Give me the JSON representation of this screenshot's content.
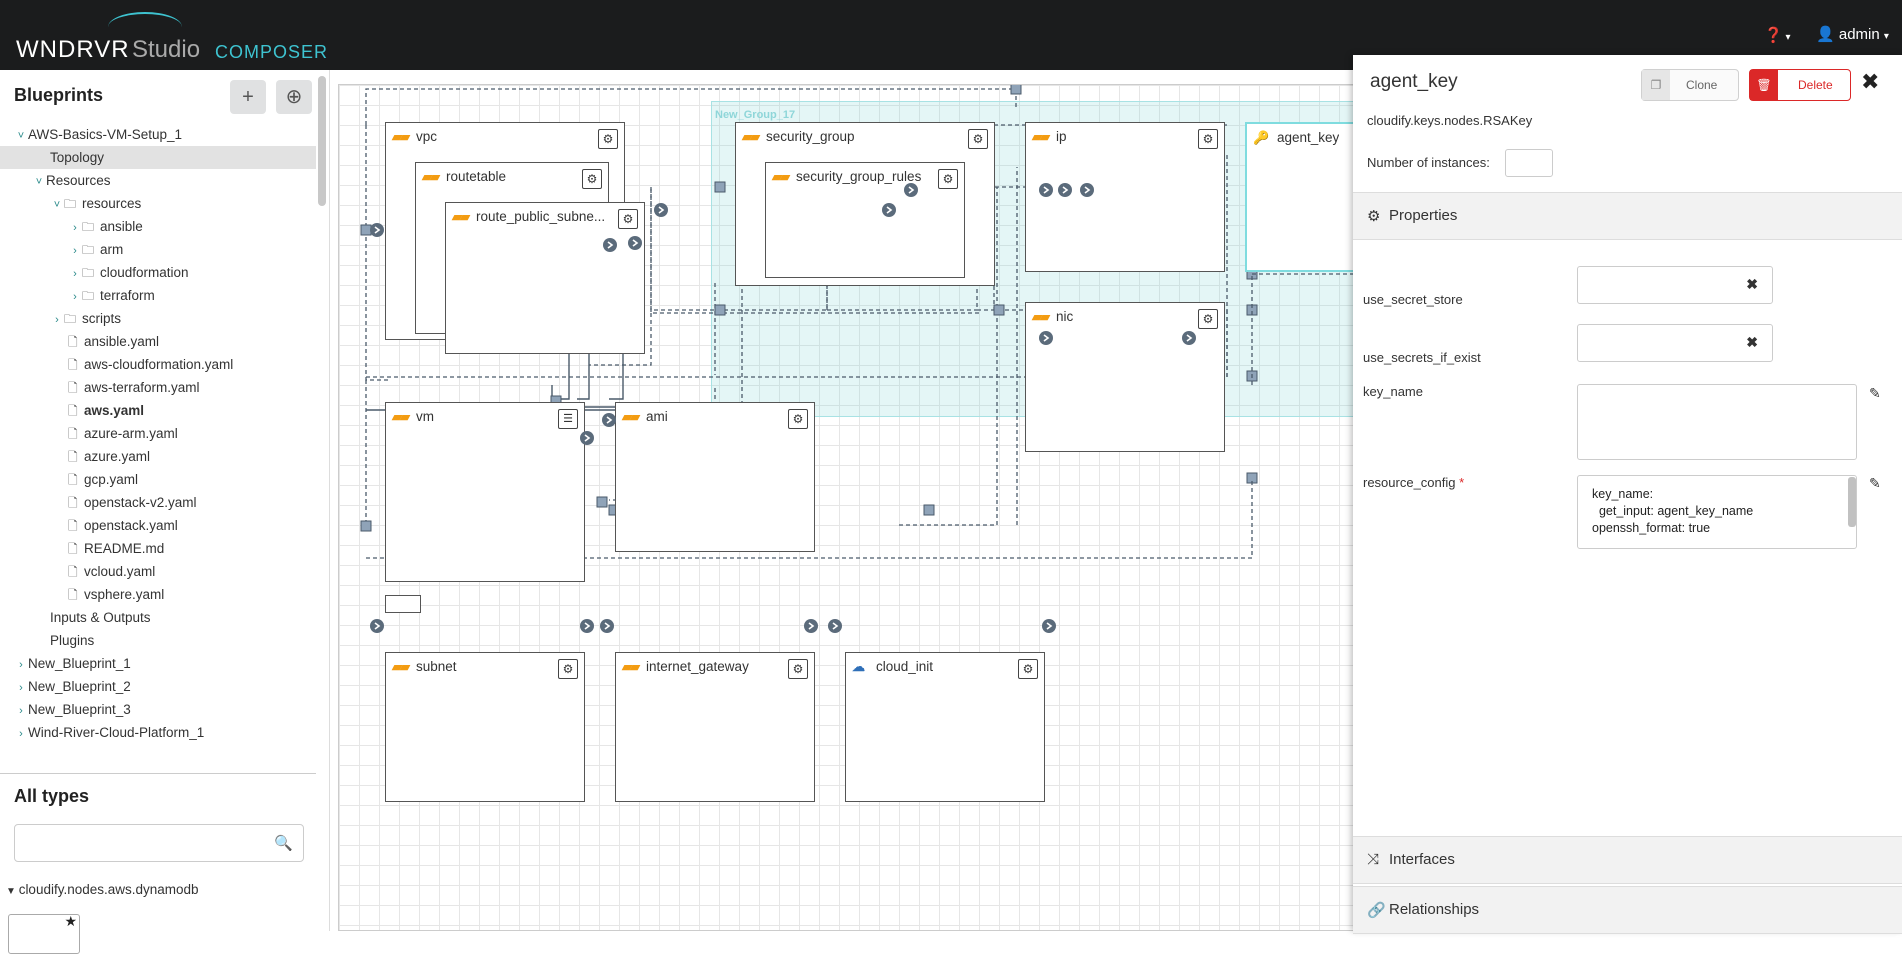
{
  "header": {
    "logo_main": "WNDRVR",
    "logo_studio": "Studio",
    "logo_product": "COMPOSER",
    "help_label": "?",
    "user_label": "admin"
  },
  "sidebar": {
    "title": "Blueprints",
    "add_label": "+",
    "import_label": "⊕",
    "tree": [
      {
        "label": "AWS-Basics-VM-Setup_1",
        "indent": 0,
        "chev": "down",
        "kind": "none",
        "selected": false
      },
      {
        "label": "Topology",
        "indent": 2,
        "chev": "",
        "kind": "none",
        "selected": true
      },
      {
        "label": "Resources",
        "indent": 1,
        "chev": "down",
        "kind": "none",
        "selected": false
      },
      {
        "label": "resources",
        "indent": 2,
        "chev": "down",
        "kind": "folder",
        "selected": false
      },
      {
        "label": "ansible",
        "indent": 3,
        "chev": "right",
        "kind": "folder",
        "selected": false
      },
      {
        "label": "arm",
        "indent": 3,
        "chev": "right",
        "kind": "folder",
        "selected": false
      },
      {
        "label": "cloudformation",
        "indent": 3,
        "chev": "right",
        "kind": "folder",
        "selected": false
      },
      {
        "label": "terraform",
        "indent": 3,
        "chev": "right",
        "kind": "folder",
        "selected": false
      },
      {
        "label": "scripts",
        "indent": 2,
        "chev": "right",
        "kind": "folder",
        "selected": false
      },
      {
        "label": "ansible.yaml",
        "indent": 3,
        "chev": "",
        "kind": "file",
        "selected": false
      },
      {
        "label": "aws-cloudformation.yaml",
        "indent": 3,
        "chev": "",
        "kind": "file",
        "selected": false
      },
      {
        "label": "aws-terraform.yaml",
        "indent": 3,
        "chev": "",
        "kind": "file",
        "selected": false
      },
      {
        "label": "aws.yaml",
        "indent": 3,
        "chev": "",
        "kind": "file",
        "selected": false,
        "bold": true
      },
      {
        "label": "azure-arm.yaml",
        "indent": 3,
        "chev": "",
        "kind": "file",
        "selected": false
      },
      {
        "label": "azure.yaml",
        "indent": 3,
        "chev": "",
        "kind": "file",
        "selected": false
      },
      {
        "label": "gcp.yaml",
        "indent": 3,
        "chev": "",
        "kind": "file",
        "selected": false
      },
      {
        "label": "openstack-v2.yaml",
        "indent": 3,
        "chev": "",
        "kind": "file",
        "selected": false
      },
      {
        "label": "openstack.yaml",
        "indent": 3,
        "chev": "",
        "kind": "file",
        "selected": false
      },
      {
        "label": "README.md",
        "indent": 3,
        "chev": "",
        "kind": "file",
        "selected": false
      },
      {
        "label": "vcloud.yaml",
        "indent": 3,
        "chev": "",
        "kind": "file",
        "selected": false
      },
      {
        "label": "vsphere.yaml",
        "indent": 3,
        "chev": "",
        "kind": "file",
        "selected": false
      },
      {
        "label": "Inputs & Outputs",
        "indent": 2,
        "chev": "",
        "kind": "none",
        "selected": false
      },
      {
        "label": "Plugins",
        "indent": 2,
        "chev": "",
        "kind": "none",
        "selected": false
      },
      {
        "label": "New_Blueprint_1",
        "indent": 0,
        "chev": "right",
        "kind": "none",
        "selected": false
      },
      {
        "label": "New_Blueprint_2",
        "indent": 0,
        "chev": "right",
        "kind": "none",
        "selected": false
      },
      {
        "label": "New_Blueprint_3",
        "indent": 0,
        "chev": "right",
        "kind": "none",
        "selected": false
      },
      {
        "label": "Wind-River-Cloud-Platform_1",
        "indent": 0,
        "chev": "right",
        "kind": "none",
        "selected": false
      }
    ],
    "types_title": "All types",
    "types_search_placeholder": "",
    "types_item": "cloudify.nodes.aws.dynamodb"
  },
  "canvas": {
    "group_label": "New_Group_17",
    "nodes": [
      {
        "id": "vpc",
        "label": "vpc"
      },
      {
        "id": "routetable",
        "label": "routetable"
      },
      {
        "id": "route_public_subnet",
        "label": "route_public_subne..."
      },
      {
        "id": "security_group",
        "label": "security_group"
      },
      {
        "id": "security_group_rules",
        "label": "security_group_rules"
      },
      {
        "id": "ip",
        "label": "ip"
      },
      {
        "id": "agent_key",
        "label": "agent_key"
      },
      {
        "id": "nic",
        "label": "nic"
      },
      {
        "id": "vm",
        "label": "vm"
      },
      {
        "id": "ami",
        "label": "ami"
      },
      {
        "id": "subnet",
        "label": "subnet"
      },
      {
        "id": "internet_gateway",
        "label": "internet_gateway"
      },
      {
        "id": "cloud_init",
        "label": "cloud_init"
      }
    ]
  },
  "panel": {
    "title": "agent_key",
    "clone_label": "Clone",
    "delete_label": "Delete",
    "type": "cloudify.keys.nodes.RSAKey",
    "instances_label": "Number of instances:",
    "instances_value": "",
    "properties_label": "Properties",
    "props": {
      "use_secret_store": "use_secret_store",
      "use_secrets_if_exist": "use_secrets_if_exist",
      "key_name": "key_name",
      "resource_config": "resource_config",
      "required_mark": "*"
    },
    "resource_config_value": "key_name:\n  get_input: agent_key_name\nopenssh_format: true",
    "interfaces_label": "Interfaces",
    "relationships_label": "Relationships"
  }
}
